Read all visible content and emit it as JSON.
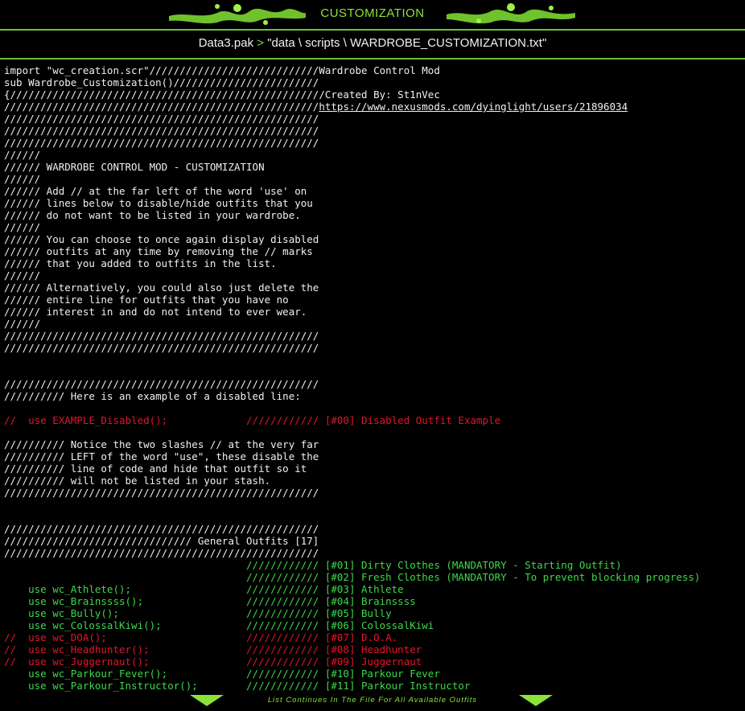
{
  "banner": {
    "title": "CUSTOMIZATION"
  },
  "path": {
    "pak": "Data3.pak",
    "arrow": ">",
    "file": "\"data \\ scripts \\ WARDROBE_CUSTOMIZATION.txt\""
  },
  "code_lines": [
    {
      "text": "import \"wc_creation.scr\"////////////////////////////Wardrobe Control Mod",
      "color": "white"
    },
    {
      "text": "sub Wardrobe_Customization()////////////////////////",
      "color": "white"
    },
    {
      "text": "{////////////////////////////////////////////////////Created By: St1nVec",
      "color": "white"
    },
    {
      "text": "////////////////////////////////////////////////////",
      "color": "white",
      "link": "https://www.nexusmods.com/dyinglight/users/21896034"
    },
    {
      "text": "////////////////////////////////////////////////////",
      "color": "white"
    },
    {
      "text": "////////////////////////////////////////////////////",
      "color": "white"
    },
    {
      "text": "////////////////////////////////////////////////////",
      "color": "white"
    },
    {
      "text": "//////",
      "color": "white"
    },
    {
      "text": "////// WARDROBE CONTROL MOD - CUSTOMIZATION",
      "color": "white"
    },
    {
      "text": "//////",
      "color": "white"
    },
    {
      "text": "////// Add // at the far left of the word 'use' on",
      "color": "white"
    },
    {
      "text": "////// lines below to disable/hide outfits that you",
      "color": "white"
    },
    {
      "text": "////// do not want to be listed in your wardrobe.",
      "color": "white"
    },
    {
      "text": "//////",
      "color": "white"
    },
    {
      "text": "////// You can choose to once again display disabled",
      "color": "white"
    },
    {
      "text": "////// outfits at any time by removing the // marks",
      "color": "white"
    },
    {
      "text": "////// that you added to outfits in the list.",
      "color": "white"
    },
    {
      "text": "//////",
      "color": "white"
    },
    {
      "text": "////// Alternatively, you could also just delete the",
      "color": "white"
    },
    {
      "text": "////// entire line for outfits that you have no",
      "color": "white"
    },
    {
      "text": "////// interest in and do not intend to ever wear.",
      "color": "white"
    },
    {
      "text": "//////",
      "color": "white"
    },
    {
      "text": "////////////////////////////////////////////////////",
      "color": "white"
    },
    {
      "text": "////////////////////////////////////////////////////",
      "color": "white"
    },
    {
      "text": "",
      "color": "white"
    },
    {
      "text": "",
      "color": "white"
    },
    {
      "text": "////////////////////////////////////////////////////",
      "color": "white"
    },
    {
      "text": "////////// Here is an example of a disabled line:",
      "color": "white"
    },
    {
      "text": "",
      "color": "white"
    },
    {
      "text": "//  use EXAMPLE_Disabled();             //////////// [#00] Disabled Outfit Example",
      "color": "red"
    },
    {
      "text": "",
      "color": "white"
    },
    {
      "text": "////////// Notice the two slashes // at the very far",
      "color": "white"
    },
    {
      "text": "////////// LEFT of the word \"use\", these disable the",
      "color": "white"
    },
    {
      "text": "////////// line of code and hide that outfit so it",
      "color": "white"
    },
    {
      "text": "////////// will not be listed in your stash.",
      "color": "white"
    },
    {
      "text": "////////////////////////////////////////////////////",
      "color": "white"
    },
    {
      "text": "",
      "color": "white"
    },
    {
      "text": "",
      "color": "white"
    },
    {
      "text": "////////////////////////////////////////////////////",
      "color": "white"
    },
    {
      "text": "/////////////////////////////// General Outfits [17]",
      "color": "white"
    },
    {
      "text": "////////////////////////////////////////////////////",
      "color": "white"
    },
    {
      "text": "                                        //////////// [#01] Dirty Clothes (MANDATORY - Starting Outfit)",
      "color": "green"
    },
    {
      "text": "                                        //////////// [#02] Fresh Clothes (MANDATORY - To prevent blocking progress)",
      "color": "green"
    },
    {
      "text": "    use wc_Athlete();                   //////////// [#03] Athlete",
      "color": "green"
    },
    {
      "text": "    use wc_Brainssss();                 //////////// [#04] Brainssss",
      "color": "green"
    },
    {
      "text": "    use wc_Bully();                     //////////// [#05] Bully",
      "color": "green"
    },
    {
      "text": "    use wc_ColossalKiwi();              //////////// [#06] ColossalKiwi",
      "color": "green"
    },
    {
      "text": "//  use wc_DOA();                       //////////// [#07] D.O.A.",
      "color": "red"
    },
    {
      "text": "//  use wc_Headhunter();                //////////// [#08] Headhunter",
      "color": "red"
    },
    {
      "text": "//  use wc_Juggernaut();                //////////// [#09] Juggernaut",
      "color": "red"
    },
    {
      "text": "    use wc_Parkour_Fever();             //////////// [#10] Parkour Fever",
      "color": "green"
    },
    {
      "text": "    use wc_Parkour_Instructor();        //////////// [#11] Parkour Instructor",
      "color": "green"
    }
  ],
  "footer": {
    "text": "List Continues In The File For All Available Outfits"
  },
  "colors": {
    "accent": "#8be33a",
    "green_text": "#3ed84a",
    "red_text": "#e0162b",
    "background": "#000000",
    "text": "#f0f0f0"
  }
}
